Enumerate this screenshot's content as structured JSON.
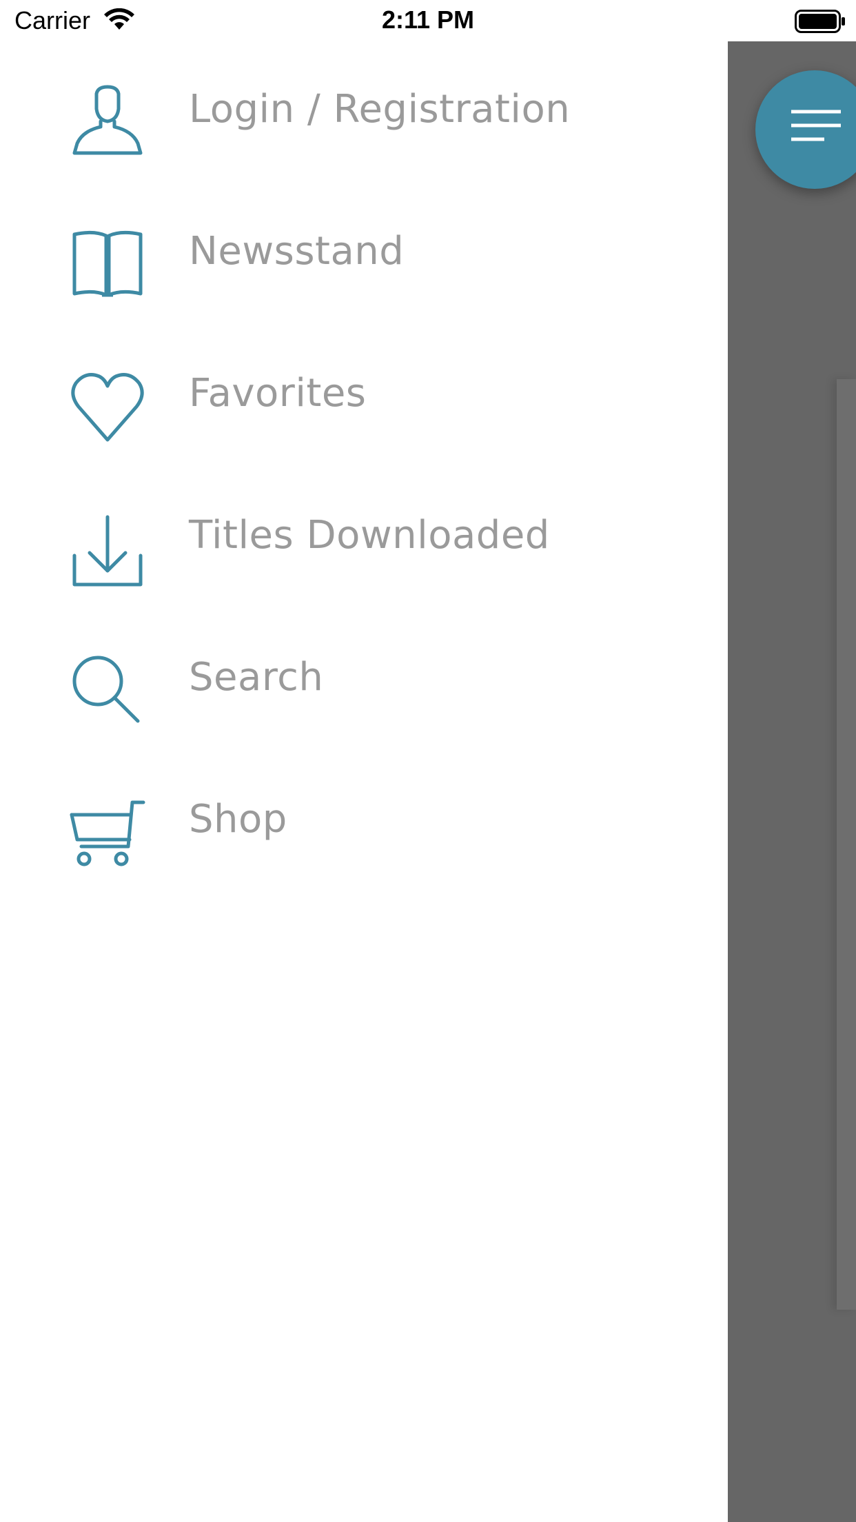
{
  "status_bar": {
    "carrier": "Carrier",
    "time": "2:11 PM",
    "wifi_icon": "wifi-icon",
    "battery_icon": "battery-full-icon"
  },
  "drawer": {
    "accent_color": "#3e8aa4",
    "label_color": "#9a9a9a",
    "items": [
      {
        "label": "Login / Registration",
        "icon": "user-icon"
      },
      {
        "label": "Newsstand",
        "icon": "open-book-icon"
      },
      {
        "label": "Favorites",
        "icon": "heart-icon"
      },
      {
        "label": "Titles Downloaded",
        "icon": "download-icon"
      },
      {
        "label": "Search",
        "icon": "search-icon"
      },
      {
        "label": "Shop",
        "icon": "cart-icon"
      }
    ]
  },
  "fab": {
    "icon": "menu-icon",
    "color": "#3e8aa4"
  },
  "overlay_color": "#666666"
}
